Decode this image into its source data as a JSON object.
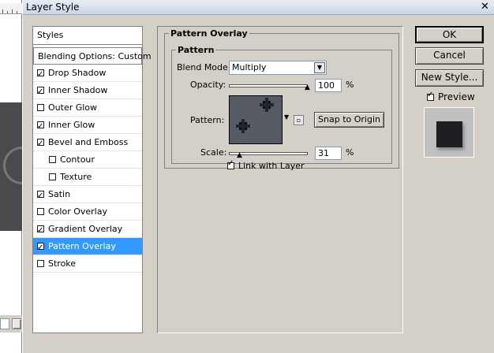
{
  "window": {
    "title": "Layer Style",
    "close_glyph": "✕"
  },
  "styles_list": {
    "header": "Styles",
    "blending_options": "Blending Options: Custom",
    "items": [
      {
        "label": "Drop Shadow",
        "checked": true,
        "indent": false,
        "selected": false
      },
      {
        "label": "Inner Shadow",
        "checked": true,
        "indent": false,
        "selected": false
      },
      {
        "label": "Outer Glow",
        "checked": false,
        "indent": false,
        "selected": false
      },
      {
        "label": "Inner Glow",
        "checked": true,
        "indent": false,
        "selected": false
      },
      {
        "label": "Bevel and Emboss",
        "checked": true,
        "indent": false,
        "selected": false
      },
      {
        "label": "Contour",
        "checked": false,
        "indent": true,
        "selected": false
      },
      {
        "label": "Texture",
        "checked": false,
        "indent": true,
        "selected": false
      },
      {
        "label": "Satin",
        "checked": true,
        "indent": false,
        "selected": false
      },
      {
        "label": "Color Overlay",
        "checked": false,
        "indent": false,
        "selected": false
      },
      {
        "label": "Gradient Overlay",
        "checked": true,
        "indent": false,
        "selected": false
      },
      {
        "label": "Pattern Overlay",
        "checked": true,
        "indent": false,
        "selected": true
      },
      {
        "label": "Stroke",
        "checked": false,
        "indent": false,
        "selected": false
      }
    ]
  },
  "pattern_overlay": {
    "section_title": "Pattern Overlay",
    "group_title": "Pattern",
    "blend_mode_label": "Blend Mode:",
    "blend_mode_value": "Multiply",
    "opacity_label": "Opacity:",
    "opacity_value": "100",
    "opacity_fraction": 1.0,
    "percent": "%",
    "pattern_label": "Pattern:",
    "snap_to_origin": "Snap to Origin",
    "scale_label": "Scale:",
    "scale_value": "31",
    "scale_fraction": 0.14,
    "link_with_layer": "Link with Layer",
    "link_checked": true
  },
  "buttons": {
    "ok": "OK",
    "cancel": "Cancel",
    "new_style": "New Style..."
  },
  "preview": {
    "label": "Preview",
    "checked": true
  },
  "colors": {
    "selection": "#3399ff",
    "dialog_bg": "#d4d0c8"
  }
}
